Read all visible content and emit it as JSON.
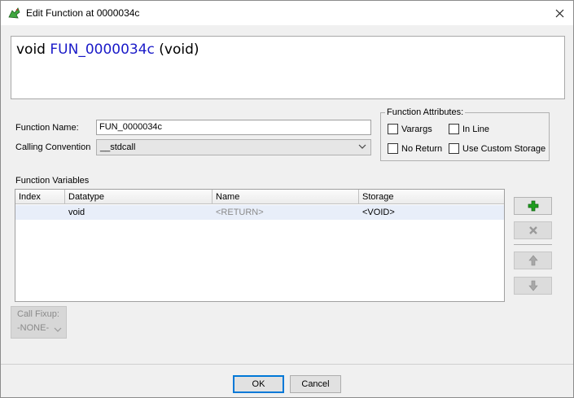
{
  "window": {
    "title": "Edit Function at 0000034c"
  },
  "signature": {
    "return_type": "void",
    "name": "FUN_0000034c",
    "params": "(void)"
  },
  "form": {
    "function_name_label": "Function Name:",
    "function_name_value": "FUN_0000034c",
    "calling_convention_label": "Calling Convention",
    "calling_convention_value": "__stdcall"
  },
  "attributes": {
    "legend": "Function Attributes:",
    "varargs": "Varargs",
    "inline": "In Line",
    "no_return": "No Return",
    "custom_storage": "Use Custom Storage"
  },
  "variables": {
    "label": "Function Variables",
    "columns": [
      "Index",
      "Datatype",
      "Name",
      "Storage"
    ],
    "rows": [
      {
        "index": "",
        "datatype": "void",
        "name": "<RETURN>",
        "storage": "<VOID>"
      }
    ]
  },
  "fixup": {
    "label": "Call Fixup:",
    "value": "-NONE-"
  },
  "buttons": {
    "ok": "OK",
    "cancel": "Cancel"
  },
  "colors": {
    "accent": "#0078d7",
    "function_name": "#1a1ac8",
    "add_icon": "#1e9e1e"
  }
}
